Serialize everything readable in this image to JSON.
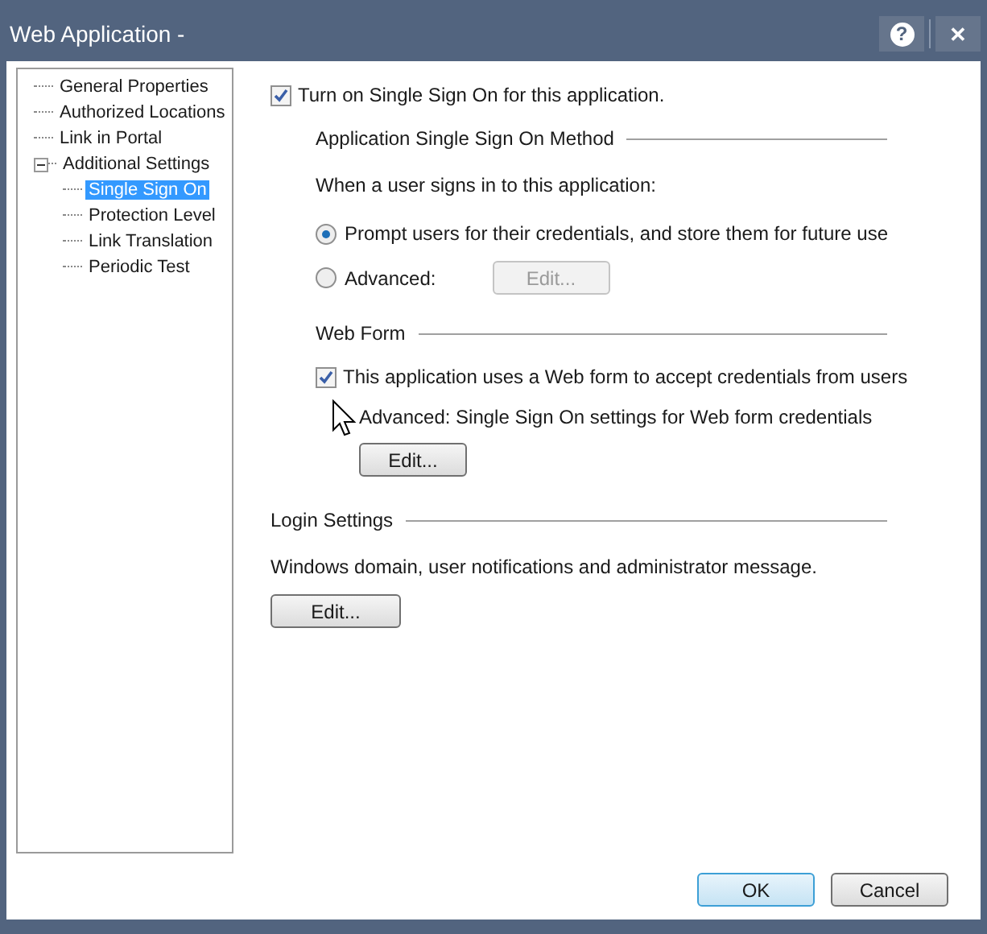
{
  "window": {
    "title": "Web Application -",
    "help": "?",
    "close": "✕"
  },
  "tree": [
    {
      "label": "General Properties",
      "selected": false
    },
    {
      "label": "Authorized Locations",
      "selected": false
    },
    {
      "label": "Link in Portal",
      "selected": false
    },
    {
      "label": "Additional Settings",
      "selected": false,
      "expanded": true,
      "children": [
        {
          "label": "Single Sign On",
          "selected": true
        },
        {
          "label": "Protection Level",
          "selected": false
        },
        {
          "label": "Link Translation",
          "selected": false
        },
        {
          "label": "Periodic Test",
          "selected": false
        }
      ]
    }
  ],
  "sso_checkbox": {
    "label": "Turn on Single Sign On for this application.",
    "checked": true
  },
  "method": {
    "heading": "Application Single Sign On Method",
    "prompt": "When a user signs in to this application:",
    "options": [
      {
        "label": "Prompt users for their credentials, and store them for future use",
        "selected": true
      },
      {
        "label": "Advanced:",
        "selected": false,
        "button": {
          "label": "Edit...",
          "disabled": true
        }
      }
    ]
  },
  "web_form": {
    "heading": "Web Form",
    "checkbox": {
      "label": "This application uses a Web form to accept credentials from users",
      "checked": true
    },
    "note": "Advanced: Single Sign On settings for Web form credentials",
    "button": {
      "label": "Edit...",
      "disabled": false
    }
  },
  "login": {
    "heading": "Login Settings",
    "description": "Windows domain, user notifications and administrator message.",
    "button": {
      "label": "Edit...",
      "disabled": false
    }
  },
  "footer": [
    {
      "label": "OK",
      "default": true
    },
    {
      "label": "Cancel",
      "default": false
    }
  ]
}
